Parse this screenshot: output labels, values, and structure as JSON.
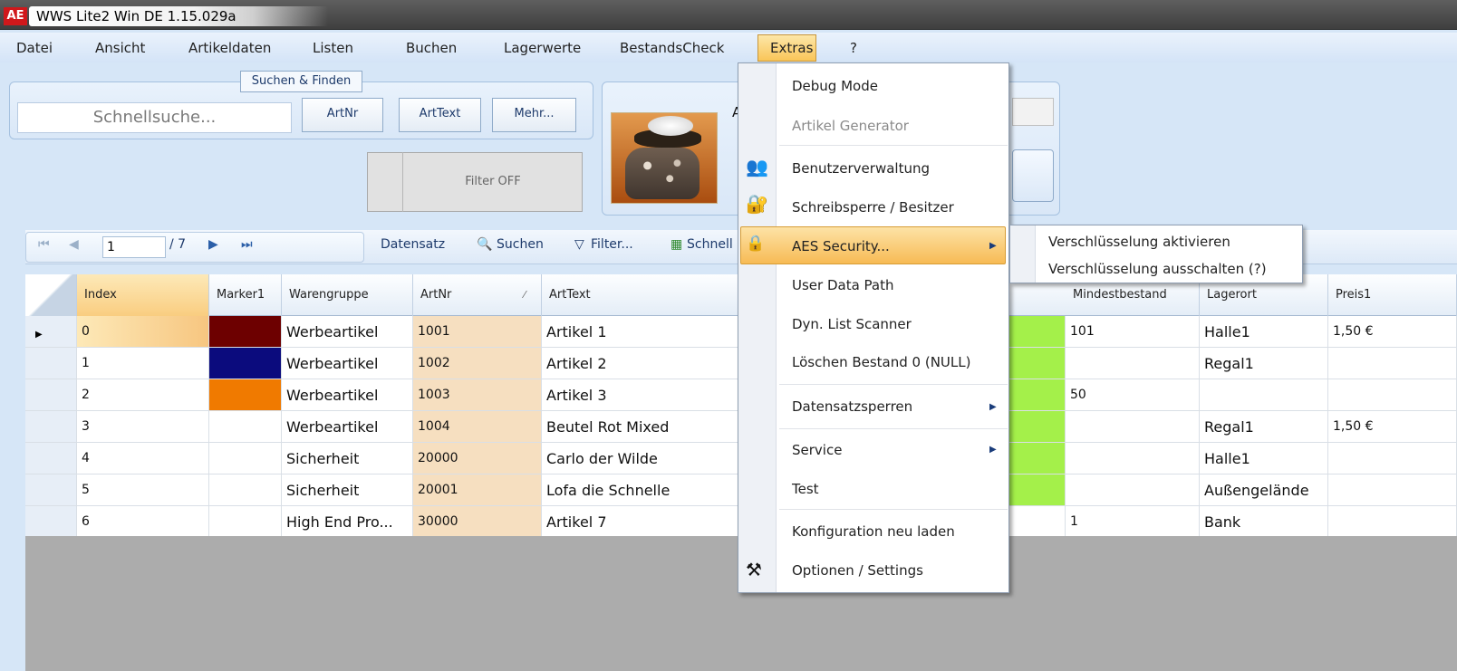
{
  "window": {
    "title": "WWS Lite2 Win DE 1.15.029a",
    "logo": "AE"
  },
  "menubar": {
    "items": [
      "Datei",
      "Ansicht",
      "Artikeldaten",
      "Listen",
      "Buchen",
      "Lagerwerte",
      "BestandsCheck",
      "Extras",
      "?"
    ]
  },
  "search": {
    "group_label": "Suchen & Finden",
    "placeholder": "Schnellsuche...",
    "buttons": [
      "ArtNr",
      "ArtText",
      "Mehr..."
    ],
    "filter_label": "Filter OFF"
  },
  "article_panel": {
    "label": "Arti"
  },
  "navigator": {
    "page": "1",
    "total": "/ 7",
    "datensatz": "Datensatz",
    "suchen": "Suchen",
    "filter": "Filter...",
    "schnell": "Schnell"
  },
  "grid": {
    "columns": [
      "Index",
      "Marker1",
      "Warengruppe",
      "ArtNr",
      "ArtText",
      "Mindestbestand",
      "Lagerort",
      "Preis1"
    ],
    "rows": [
      {
        "index": "0",
        "marker": "#6d0000",
        "group": "Werbeartikel",
        "artnr": "1001",
        "arttext": "Artikel 1",
        "min": "101",
        "lager": "Halle1",
        "preis": "1,50 €"
      },
      {
        "index": "1",
        "marker": "#0b0b7d",
        "group": "Werbeartikel",
        "artnr": "1002",
        "arttext": "Artikel 2",
        "min": "",
        "lager": "Regal1",
        "preis": ""
      },
      {
        "index": "2",
        "marker": "#f07a00",
        "group": "Werbeartikel",
        "artnr": "1003",
        "arttext": "Artikel 3",
        "min": "50",
        "lager": "",
        "preis": ""
      },
      {
        "index": "3",
        "marker": "",
        "group": "Werbeartikel",
        "artnr": "1004",
        "arttext": "Beutel Rot Mixed",
        "min": "",
        "lager": "Regal1",
        "preis": "1,50 €"
      },
      {
        "index": "4",
        "marker": "",
        "group": "Sicherheit",
        "artnr": "20000",
        "arttext": "Carlo der Wilde",
        "min": "",
        "lager": "Halle1",
        "preis": ""
      },
      {
        "index": "5",
        "marker": "",
        "group": "Sicherheit",
        "artnr": "20001",
        "arttext": "Lofa die Schnelle",
        "min": "",
        "lager": "Außengelände",
        "preis": ""
      },
      {
        "index": "6",
        "marker": "",
        "group": "High End Pro...",
        "artnr": "30000",
        "arttext": "Artikel 7",
        "min": "1",
        "lager": "Bank",
        "preis": ""
      }
    ]
  },
  "extras_menu": {
    "items": [
      "Debug Mode",
      "Artikel Generator",
      "Benutzerverwaltung",
      "Schreibsperre / Besitzer",
      "AES Security...",
      "User Data Path",
      "Dyn. List Scanner",
      "Löschen Bestand 0 (NULL)",
      "Datensatzsperren",
      "Service",
      "Test",
      "Konfiguration neu laden",
      "Optionen / Settings"
    ]
  },
  "aes_submenu": {
    "items": [
      "Verschlüsselung aktivieren",
      "Verschlüsselung ausschalten (?)"
    ]
  },
  "colors": {
    "accent": "#f7bb55",
    "artnr_bg": "#f6dfc0",
    "green_bg": "#a4f04a"
  }
}
